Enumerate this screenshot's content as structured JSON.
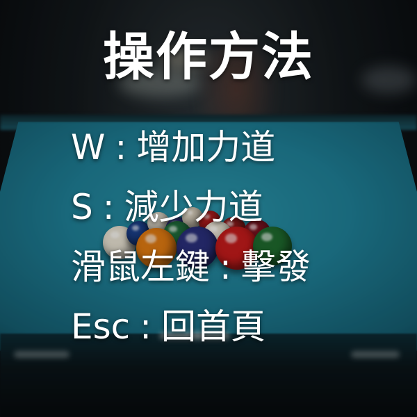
{
  "title": "操作方法",
  "controls": [
    {
      "key": "W",
      "sep": ":",
      "action": "增加力道"
    },
    {
      "key": "S",
      "sep": ":",
      "action": "減少力道"
    },
    {
      "key": "滑鼠左鍵",
      "sep": ":",
      "action": "擊發"
    },
    {
      "key": "Esc",
      "sep": ":",
      "action": "回首頁"
    }
  ],
  "background": {
    "subject": "pool-table-with-racked-balls",
    "colors": {
      "felt": "#1f7f96",
      "text": "#ffffff"
    }
  }
}
